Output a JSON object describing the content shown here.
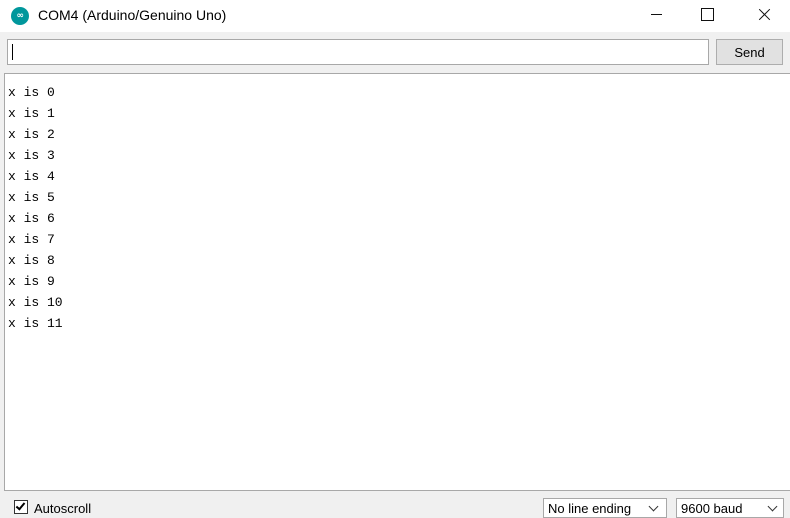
{
  "window": {
    "title": "COM4 (Arduino/Genuino Uno)",
    "icon": "arduino-logo-icon",
    "icon_label": "∞",
    "controls": [
      "minimize-icon",
      "maximize-icon",
      "close-icon"
    ]
  },
  "input": {
    "value": "",
    "send_label": "Send"
  },
  "output_lines": [
    "x is 0",
    "x is 1",
    "x is 2",
    "x is 3",
    "x is 4",
    "x is 5",
    "x is 6",
    "x is 7",
    "x is 8",
    "x is 9",
    "x is 10",
    "x is 11"
  ],
  "footer": {
    "autoscroll_label": "Autoscroll",
    "autoscroll_checked": true,
    "line_ending": "No line ending",
    "baud_rate": "9600 baud"
  },
  "colors": {
    "arduino_teal": "#00979c"
  }
}
